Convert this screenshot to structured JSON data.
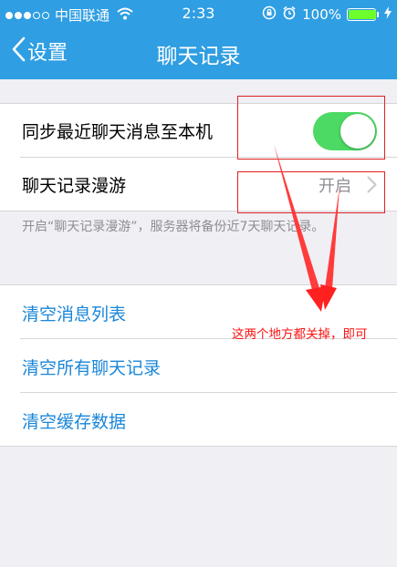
{
  "status_bar": {
    "carrier": "中国联通",
    "time": "2:33",
    "battery": "100%",
    "signal_bars_filled": 3,
    "signal_bars_total": 5,
    "battery_level": 1.0
  },
  "nav": {
    "back_label": "设置",
    "title": "聊天记录"
  },
  "settings": {
    "sync_label": "同步最近聊天消息至本机",
    "sync_on": true,
    "roaming_label": "聊天记录漫游",
    "roaming_value": "开启",
    "footnote": "开启“聊天记录漫游”，服务器将备份近7天聊天记录。"
  },
  "actions": [
    {
      "label": "清空消息列表"
    },
    {
      "label": "清空所有聊天记录"
    },
    {
      "label": "清空缓存数据"
    }
  ],
  "annotation": {
    "note": "这两个地方都关掉，即可"
  },
  "colors": {
    "nav_background": "#2f9ee3",
    "toggle_on": "#4cd964",
    "action_text": "#1a86d8",
    "annotation_red": "#e02020"
  },
  "icons": {
    "back": "chevron-left-icon",
    "roaming": "chevron-right-icon",
    "wifi": "wifi-icon",
    "lock": "rotation-lock-icon",
    "alarm": "alarm-icon",
    "charging": "charging-bolt-icon"
  }
}
